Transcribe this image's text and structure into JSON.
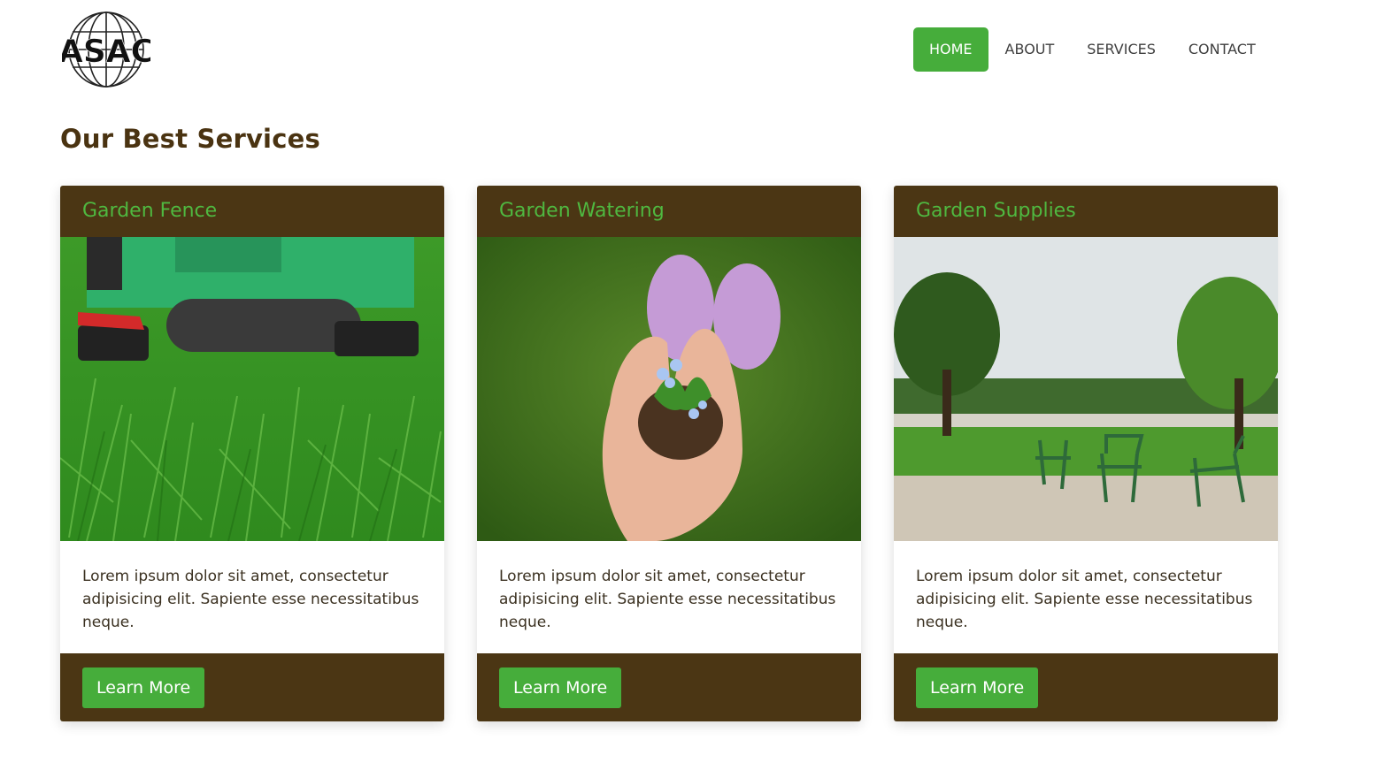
{
  "brand": {
    "logo_text": "ASAC"
  },
  "nav": {
    "items": [
      {
        "label": "HOME",
        "active": true
      },
      {
        "label": "ABOUT",
        "active": false
      },
      {
        "label": "SERVICES",
        "active": false
      },
      {
        "label": "CONTACT",
        "active": false
      }
    ]
  },
  "section": {
    "title": "Our Best Services"
  },
  "cards": [
    {
      "title": "Garden Fence",
      "image": "lawn-mower-on-grass-photo",
      "text": "Lorem ipsum dolor sit amet, consectetur adipisicing elit. Sapiente esse necessitatibus neque.",
      "button": "Learn More"
    },
    {
      "title": "Garden Watering",
      "image": "hands-holding-seedling-photo",
      "text": "Lorem ipsum dolor sit amet, consectetur adipisicing elit. Sapiente esse necessitatibus neque.",
      "button": "Learn More"
    },
    {
      "title": "Garden Supplies",
      "image": "park-with-chairs-photo",
      "text": "Lorem ipsum dolor sit amet, consectetur adipisicing elit. Sapiente esse necessitatibus neque.",
      "button": "Learn More"
    }
  ],
  "colors": {
    "brown": "#4b3614",
    "green": "#46ad3b",
    "title_green": "#4fb840",
    "heading": "#4a3311"
  }
}
